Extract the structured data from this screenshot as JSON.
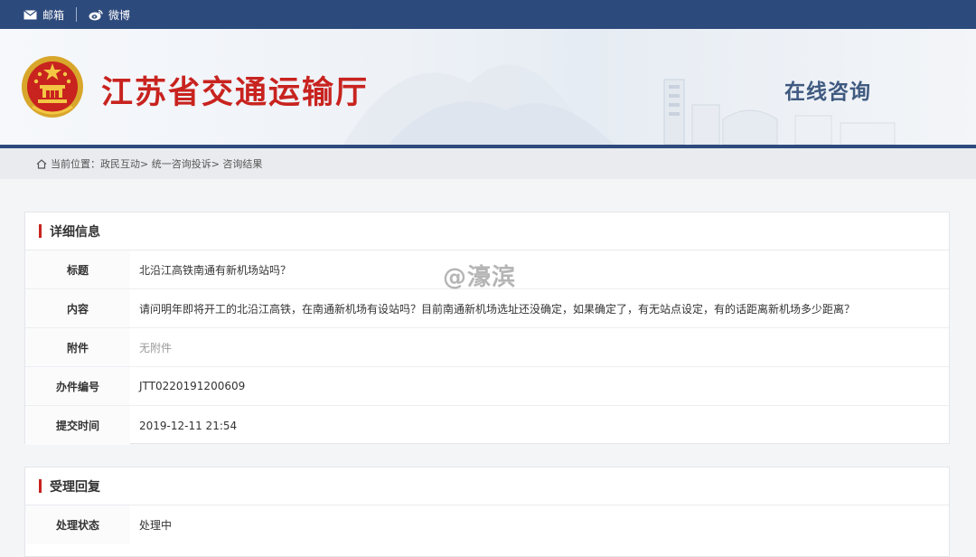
{
  "topbar": {
    "mail_label": "邮箱",
    "weibo_label": "微博"
  },
  "banner": {
    "site_title": "江苏省交通运输厅",
    "section_title": "在线咨询"
  },
  "breadcrumb": {
    "text": "当前位置：政民互动> 统一咨询投诉> 咨询结果"
  },
  "details": {
    "heading": "详细信息",
    "rows": [
      {
        "label": "标题",
        "value": "北沿江高铁南通有新机场站吗？"
      },
      {
        "label": "内容",
        "value": "请问明年即将开工的北沿江高铁，在南通新机场有设站吗？目前南通新机场选址还没确定，如果确定了，有无站点设定，有的话距离新机场多少距离？"
      },
      {
        "label": "附件",
        "value": "无附件"
      },
      {
        "label": "办件编号",
        "value": "JTT0220191200609"
      },
      {
        "label": "提交时间",
        "value": "2019-12-11 21:54"
      }
    ]
  },
  "reply": {
    "heading": "受理回复",
    "rows": [
      {
        "label": "处理状态",
        "value": "处理中"
      }
    ]
  },
  "watermark": "@濠滨",
  "colors": {
    "top_bar": "#2d4a7c",
    "title_red": "#c8231f",
    "section_blue": "#3f5a80"
  }
}
